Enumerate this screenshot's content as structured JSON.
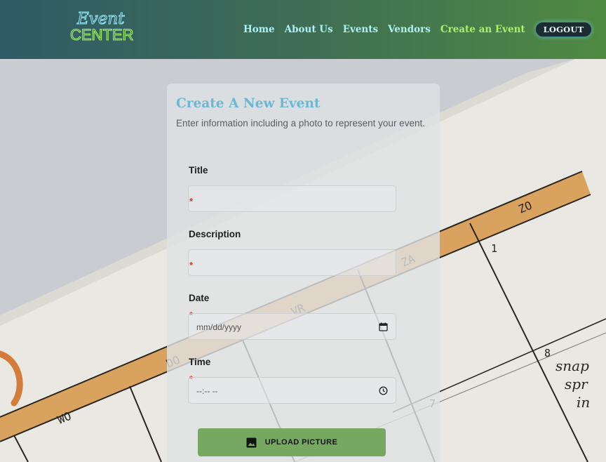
{
  "logo": {
    "line1": "Event",
    "line2": "CENTER"
  },
  "nav": {
    "items": [
      {
        "label": "Home"
      },
      {
        "label": "About Us"
      },
      {
        "label": "Events"
      },
      {
        "label": "Vendors"
      },
      {
        "label": "Create an Event"
      }
    ],
    "active_item": "Create an Event",
    "logout_label": "LOGOUT"
  },
  "card": {
    "title": "Create A New Event",
    "subtitle": "Enter information including a photo to represent your event.",
    "fields": {
      "title": {
        "label": "Title",
        "value": "",
        "required_mark": "*"
      },
      "description": {
        "label": "Description",
        "value": "",
        "required_mark": "*"
      },
      "date": {
        "label": "Date",
        "placeholder": "mm/dd/yyyy",
        "required_mark": "*"
      },
      "time": {
        "label": "Time",
        "placeholder": "--:-- --",
        "required_mark": "*"
      }
    },
    "upload_label": "UPLOAD PICTURE"
  },
  "background": {
    "planner_labels": [
      "ZO",
      "ZA",
      "VR",
      "DO",
      "WO"
    ],
    "planner_numbers": [
      "1",
      "8",
      "7"
    ],
    "handwriting": [
      "snap",
      "spr",
      "in"
    ]
  },
  "colors": {
    "header_gradient_start": "#2f5a66",
    "header_gradient_end": "#4f8a42",
    "nav_link": "#aef0f2",
    "nav_active": "#a8f06a",
    "title": "#6cb8d4",
    "required": "#d9362b",
    "upload_button": "#76a862"
  },
  "icons": [
    "calendar-icon",
    "clock-icon",
    "image-icon"
  ]
}
